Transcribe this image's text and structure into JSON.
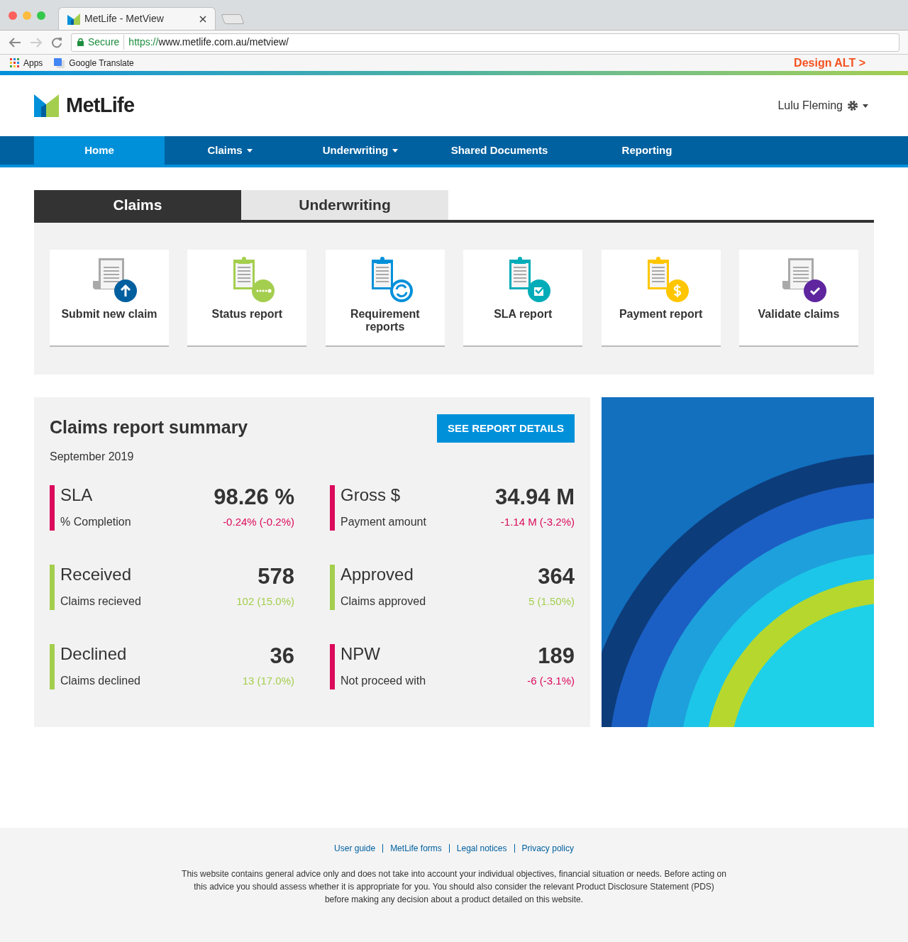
{
  "browser": {
    "tab_title": "MetLife - MetView",
    "secure_label": "Secure",
    "url_scheme": "https://",
    "url_rest": "www.metlife.com.au/metview/",
    "bookmarks": [
      {
        "kind": "apps",
        "label": "Apps"
      },
      {
        "kind": "translate",
        "label": "Google Translate"
      }
    ],
    "design_link": "Design ALT >"
  },
  "header": {
    "logo": "MetLife",
    "user": "Lulu Fleming"
  },
  "nav": [
    {
      "label": "Home",
      "selected": true,
      "dropdown": false
    },
    {
      "label": "Claims",
      "selected": false,
      "dropdown": true
    },
    {
      "label": "Underwriting",
      "selected": false,
      "dropdown": true
    },
    {
      "label": "Shared Documents",
      "selected": false,
      "dropdown": false
    },
    {
      "label": "Reporting",
      "selected": false,
      "dropdown": false
    }
  ],
  "section_tabs": [
    {
      "label": "Claims",
      "selected": true
    },
    {
      "label": "Underwriting",
      "selected": false
    }
  ],
  "tiles": [
    {
      "label": "Submit new claim",
      "kind": "upload",
      "color": "#005f9e"
    },
    {
      "label": "Status report",
      "kind": "status",
      "color": "#a4ce4e"
    },
    {
      "label": "Requirement reports",
      "kind": "refresh",
      "color": "#0090da"
    },
    {
      "label": "SLA report",
      "kind": "sla",
      "color": "#00acb8"
    },
    {
      "label": "Payment report",
      "kind": "payment",
      "color": "#ffc600"
    },
    {
      "label": "Validate claims",
      "kind": "validate",
      "color": "#5f259f"
    }
  ],
  "summary": {
    "title": "Claims report summary",
    "subtitle": "September 2019",
    "button": "SEE REPORT DETAILS",
    "metrics": [
      {
        "label": "SLA",
        "sublabel": "% Completion",
        "value": "98.26 %",
        "change": "-0.24% (-0.2%)",
        "color": "#db0a5b"
      },
      {
        "label": "Gross $",
        "sublabel": "Payment amount",
        "value": "34.94 M",
        "change": "-1.14 M (-3.2%)",
        "color": "#db0a5b"
      },
      {
        "label": "Received",
        "sublabel": "Claims recieved",
        "value": "578",
        "change": "102 (15.0%)",
        "color": "#a4ce4e"
      },
      {
        "label": "Approved",
        "sublabel": "Claims approved",
        "value": "364",
        "change": "5 (1.50%)",
        "color": "#a4ce4e"
      },
      {
        "label": "Declined",
        "sublabel": "Claims declined",
        "value": "36",
        "change": "13 (17.0%)",
        "color": "#a4ce4e"
      },
      {
        "label": "NPW",
        "sublabel": "Not proceed with",
        "value": "189",
        "change": "-6 (-3.1%)",
        "color": "#db0a5b"
      }
    ]
  },
  "footer": {
    "links": [
      "User guide",
      "MetLife forms",
      "Legal notices",
      "Privacy policy"
    ],
    "disclaimer": "This website contains general advice only and does not take into account your individual objectives, financial situation or needs. Before acting on this advice you should assess whether it is appropriate for you. You should also consider the relevant Product Disclosure Statement (PDS) before making any decision about a product detailed on this website."
  }
}
